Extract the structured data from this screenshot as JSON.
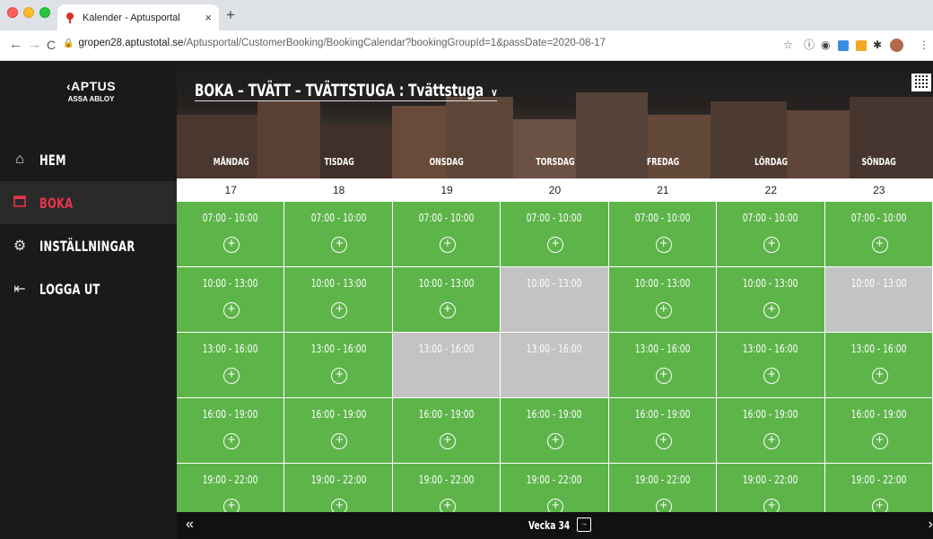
{
  "browser": {
    "tab_title": "Kalender - Aptusportal",
    "tab_close": "×",
    "new_tab": "+",
    "url_host": "gropen28.aptustotal.se",
    "url_path": "/Aptusportal/CustomerBooking/BookingCalendar?bookingGroupId=1&passDate=2020-08-17"
  },
  "logo": {
    "name": "APTUS",
    "sub": "ASSA ABLOY"
  },
  "sidebar": {
    "items": [
      {
        "label": "HEM",
        "icon": "home-icon"
      },
      {
        "label": "BOKA",
        "icon": "calendar-icon",
        "active": true
      },
      {
        "label": "INSTÄLLNINGAR",
        "icon": "gear-icon"
      },
      {
        "label": "LOGGA UT",
        "icon": "logout-icon"
      }
    ]
  },
  "header": {
    "title": "BOKA – TVÄTT – TVÄTTSTUGA : Tvättstuga",
    "dropdown": "v"
  },
  "calendar": {
    "days": [
      "MÅNDAG",
      "TISDAG",
      "ONSDAG",
      "TORSDAG",
      "FREDAG",
      "LÖRDAG",
      "SÖNDAG"
    ],
    "dates": [
      "17",
      "18",
      "19",
      "20",
      "21",
      "22",
      "23"
    ],
    "rows": [
      {
        "time": "07:00 - 10:00",
        "available": [
          true,
          true,
          true,
          true,
          true,
          true,
          true
        ]
      },
      {
        "time": "10:00 - 13:00",
        "available": [
          true,
          true,
          true,
          false,
          true,
          true,
          false
        ]
      },
      {
        "time": "13:00 - 16:00",
        "available": [
          true,
          true,
          false,
          false,
          true,
          true,
          true
        ]
      },
      {
        "time": "16:00 - 19:00",
        "available": [
          true,
          true,
          true,
          true,
          true,
          true,
          true
        ]
      },
      {
        "time": "19:00 - 22:00",
        "available": [
          true,
          true,
          true,
          true,
          true,
          true,
          true
        ]
      }
    ],
    "add_glyph": "+"
  },
  "footer": {
    "prev": "«",
    "next": "›",
    "week_label": "Vecka 34",
    "picker_glyph": "→"
  },
  "colors": {
    "available": "#5db54a",
    "booked": "#c3c3c3",
    "accent": "#e8334a"
  }
}
